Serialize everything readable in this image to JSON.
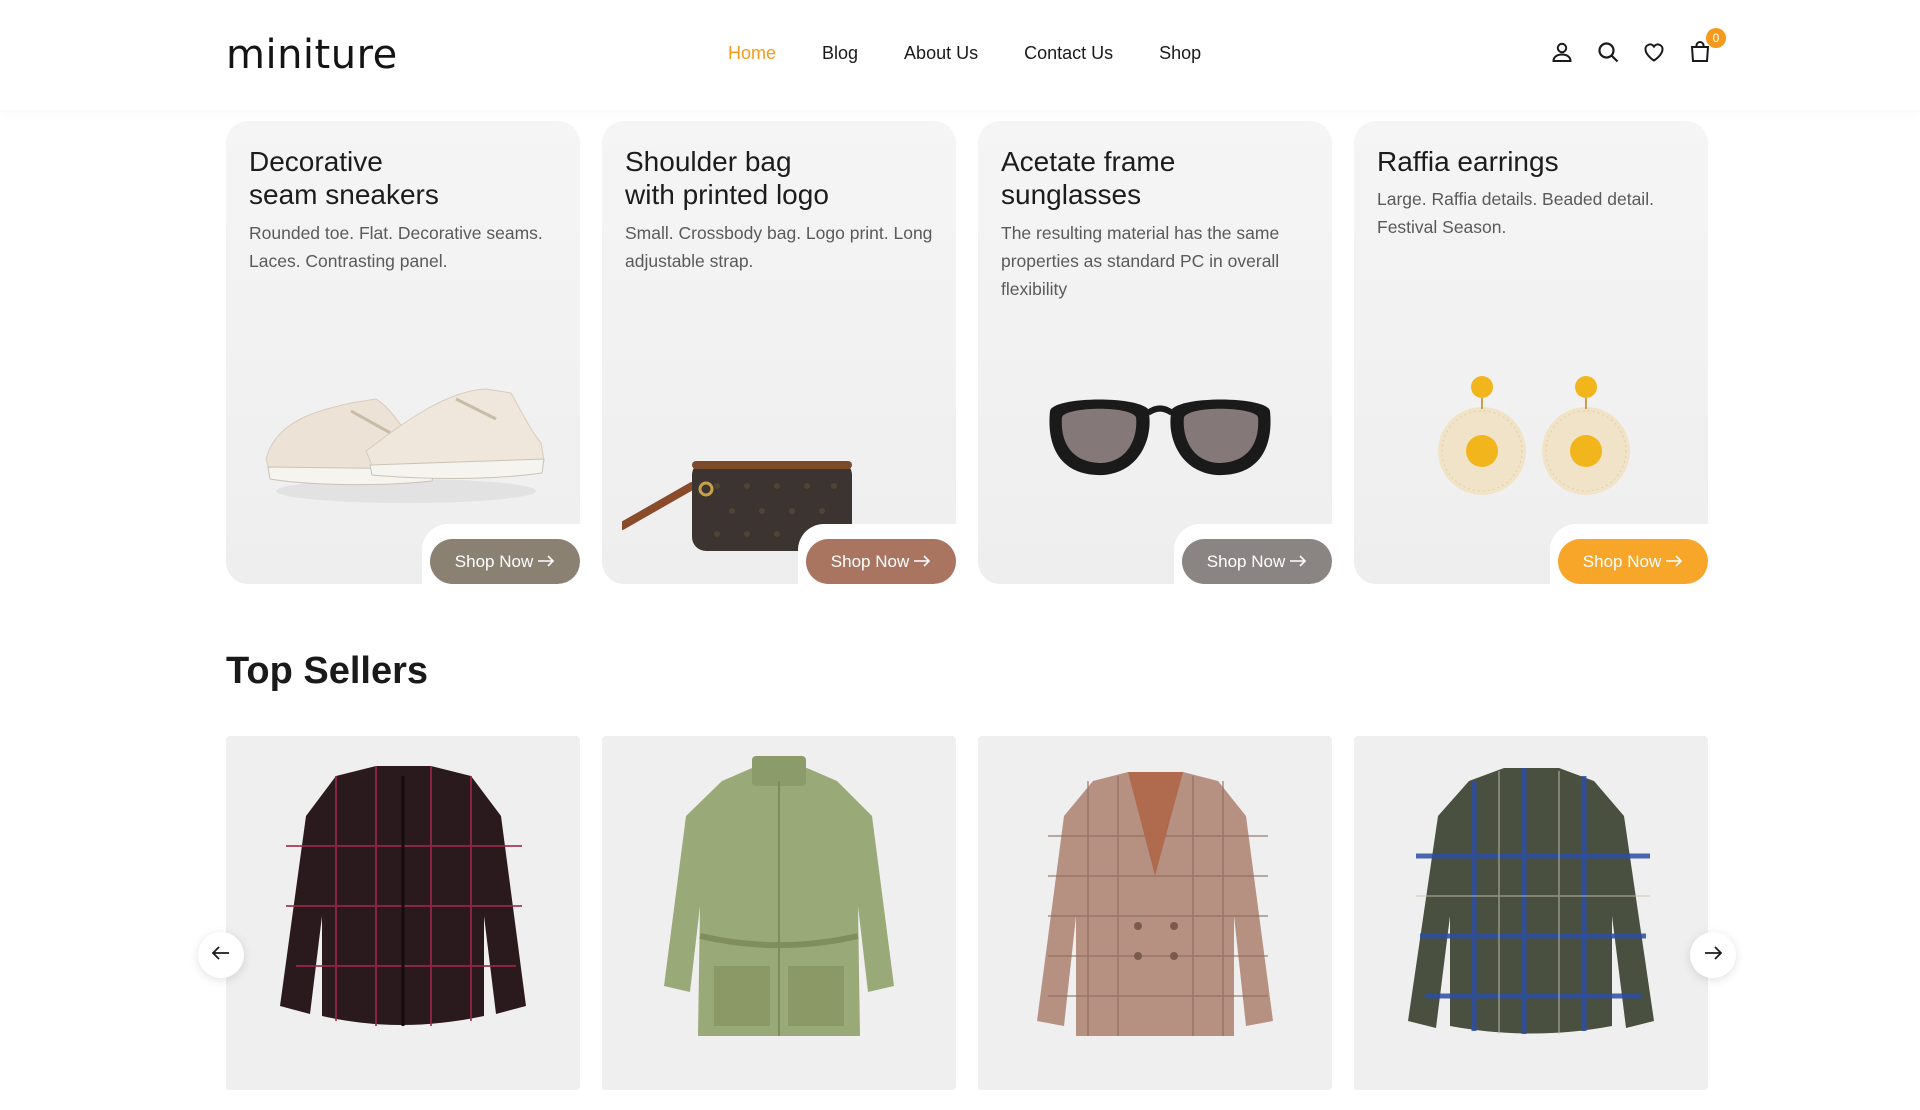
{
  "header": {
    "logo": "miniture",
    "nav": [
      {
        "label": "Home",
        "active": true
      },
      {
        "label": "Blog",
        "active": false
      },
      {
        "label": "About Us",
        "active": false
      },
      {
        "label": "Contact Us",
        "active": false
      },
      {
        "label": "Shop",
        "active": false
      }
    ],
    "icons": [
      "user-icon",
      "search-icon",
      "heart-icon",
      "cart-icon"
    ],
    "cart_count": "0",
    "accent_color": "#f59a1c"
  },
  "promo_cards": [
    {
      "title_line1": "Decorative",
      "title_line2": "seam sneakers",
      "description": "Rounded toe. Flat. Decorative seams. Laces. Contrasting panel.",
      "button": "Shop Now",
      "button_color": "#8b8173"
    },
    {
      "title_line1": "Shoulder bag",
      "title_line2": "with printed logo",
      "description": "Small. Crossbody bag. Logo print. Long adjustable strap.",
      "button": "Shop Now",
      "button_color": "#a97561"
    },
    {
      "title_line1": "Acetate frame",
      "title_line2": "sunglasses",
      "description": "The resulting material has the same properties as standard PC in overall flexibility",
      "button": "Shop Now",
      "button_color": "#8a8483"
    },
    {
      "title_line1": "Raffia earrings",
      "title_line2": "",
      "description": "Large. Raffia details. Beaded detail. Festival Season.",
      "button": "Shop Now",
      "button_color": "#f7a62a"
    }
  ],
  "top_sellers": {
    "title": "Top Sellers",
    "products": [
      {
        "name": "plaid-shirt-jacket-dark"
      },
      {
        "name": "green-utility-jacket"
      },
      {
        "name": "checked-blazer"
      },
      {
        "name": "blue-tweed-overshirt"
      }
    ]
  }
}
